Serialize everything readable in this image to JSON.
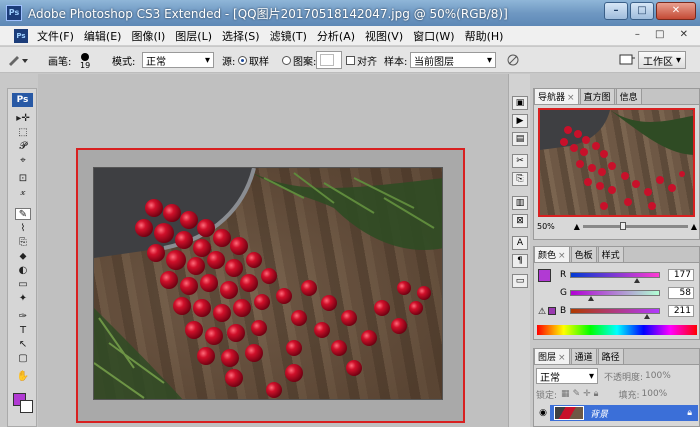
{
  "window": {
    "title": "Adobe Photoshop CS3 Extended - [QQ图片20170518142047.jpg @ 50%(RGB/8)]",
    "app_badge": "Ps",
    "controls": [
      "–",
      "□",
      "✕"
    ]
  },
  "menu": {
    "items": [
      "文件(F)",
      "编辑(E)",
      "图像(I)",
      "图层(L)",
      "选择(S)",
      "滤镜(T)",
      "分析(A)",
      "视图(V)",
      "窗口(W)",
      "帮助(H)"
    ],
    "right_controls": "– □ ✕"
  },
  "options": {
    "brush_label": "画笔:",
    "brush_size": "19",
    "mode_label": "模式:",
    "mode_value": "正常",
    "source_label": "源:",
    "source_sampled": "取样",
    "source_pattern": "图案:",
    "aligned_label": "对齐",
    "sample_label": "样本:",
    "sample_value": "当前图层",
    "workspace_label": "工作区"
  },
  "toolbar": {
    "badge": "Ps",
    "tools": [
      "▸✛",
      "⬚",
      "𝓟",
      "⌖",
      "⊡",
      "𝓍",
      "✎",
      "⌇",
      "⎘",
      "⬥",
      "◐",
      "▭",
      "✦",
      "✑",
      "T",
      "↖",
      "▢",
      "✋"
    ]
  },
  "navigator": {
    "tabs": [
      "导航器",
      "直方图",
      "信息"
    ],
    "zoom": "50%"
  },
  "color": {
    "tabs": [
      "颜色",
      "色板",
      "样式"
    ],
    "r_label": "R",
    "g_label": "G",
    "b_label": "B",
    "r": "177",
    "g": "58",
    "b": "211",
    "swatch": "#b13ad3"
  },
  "layers": {
    "tabs": [
      "图层",
      "通道",
      "路径"
    ],
    "blend_mode": "正常",
    "opacity_label": "不透明度:",
    "opacity_value": "100%",
    "lock_label": "锁定:",
    "fill_label": "填充:",
    "fill_value": "100%",
    "layer_name": "背景"
  },
  "colors": {
    "selection_border": "#d82020",
    "titlebar": "#6f98c2",
    "layer_selected": "#3b6fd8"
  }
}
